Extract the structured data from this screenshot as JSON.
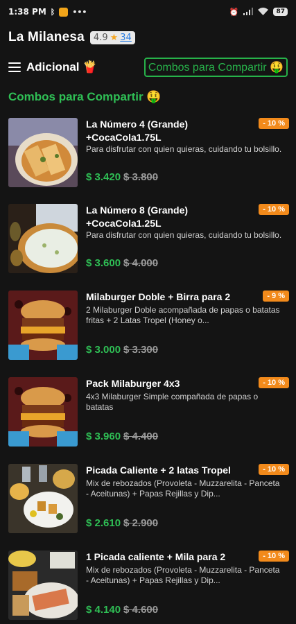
{
  "status_bar": {
    "time": "1:38 PM",
    "icons_left": [
      "bluetooth-icon",
      "app-notification-icon",
      "more-icon"
    ],
    "icons_right": [
      "alarm-icon",
      "signal-icon",
      "wifi-icon"
    ],
    "battery": "87"
  },
  "header": {
    "store_name": "La Milanesa",
    "rating": "4.9",
    "rating_count": "34"
  },
  "category_bar": {
    "label": "Adicional 🍟",
    "chip": "Combos para Compartir 🤑"
  },
  "section": {
    "title": "Combos para Compartir 🤑"
  },
  "colors": {
    "background": "#141414",
    "accent_green": "#2fbf55",
    "discount_orange": "#f28a1b"
  },
  "products": [
    {
      "title": "La Número 4 (Grande) +CocaCola1.75L",
      "description": "Para disfrutar con quien quieras, cuidando tu bolsillo.",
      "price": "$ 3.420",
      "old_price": "$ 3.800",
      "discount": "- 10 %"
    },
    {
      "title": "La Número 8 (Grande) +CocaCola1.25L",
      "description": "Para disfrutar con quien quieras, cuidando tu bolsillo.",
      "price": "$ 3.600",
      "old_price": "$ 4.000",
      "discount": "- 10 %"
    },
    {
      "title": "Milaburger Doble + Birra para 2",
      "description": "2 Milaburger Doble acompañada de papas o batatas fritas + 2 Latas Tropel (Honey o...",
      "price": "$ 3.000",
      "old_price": "$ 3.300",
      "discount": "- 9 %"
    },
    {
      "title": "Pack Milaburger 4x3",
      "description": "4x3 Milaburger Simple compañada de papas o batatas",
      "price": "$ 3.960",
      "old_price": "$ 4.400",
      "discount": "- 10 %"
    },
    {
      "title": "Picada Caliente + 2 latas Tropel",
      "description": "Mix de rebozados (Provoleta - Muzzarelita - Panceta - Aceitunas) + Papas Rejillas y Dip...",
      "price": "$ 2.610",
      "old_price": "$ 2.900",
      "discount": "- 10 %"
    },
    {
      "title": "1 Picada caliente + Mila para 2",
      "description": "Mix de rebozados (Provoleta - Muzzarelita - Panceta - Aceitunas) + Papas Rejillas y Dip...",
      "price": "$ 4.140",
      "old_price": "$ 4.600",
      "discount": "- 10 %"
    }
  ]
}
